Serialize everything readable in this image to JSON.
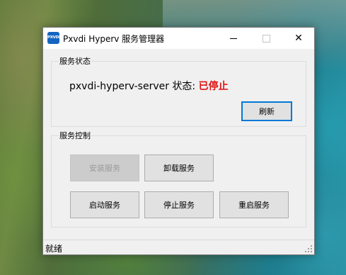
{
  "window": {
    "title": "Pxvdi Hyperv 服务管理器",
    "icon_text": "PXVDI",
    "icon_name": "pxvdi-app-icon",
    "close_glyph": "✕"
  },
  "status_group": {
    "label": "服务状态",
    "service_line": "pxvdi-hyperv-server 状态:",
    "status_value": "已停止",
    "status_color": "#e01010",
    "refresh_label": "刷新"
  },
  "control_group": {
    "label": "服务控制",
    "install_label": "安装服务",
    "uninstall_label": "卸载服务",
    "start_label": "启动服务",
    "stop_label": "停止服务",
    "restart_label": "重启服务"
  },
  "statusbar": {
    "text": "就绪"
  },
  "colors": {
    "accent": "#0078d7",
    "status_stopped": "#e01010"
  }
}
